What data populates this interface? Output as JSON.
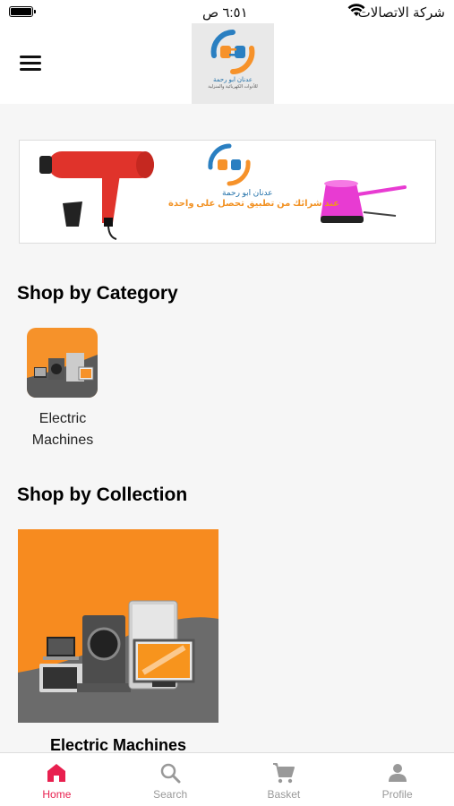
{
  "status_bar": {
    "carrier": "شركة الاتصالات",
    "time": "٦:٥١ ص"
  },
  "header": {
    "logo_name": "عدنان ابو رحمة",
    "logo_subtitle": "للأدوات الكهربائية والمنزلية"
  },
  "banner": {
    "brand_name": "عدنان ابو رحمة",
    "promo_text": "عند شرائك من تطبيق تحصل على واحدة"
  },
  "categories": {
    "title": "Shop by Category",
    "items": [
      {
        "label": "Electric Machines"
      }
    ]
  },
  "collections": {
    "title": "Shop by Collection",
    "items": [
      {
        "label": "Electric Machines"
      }
    ]
  },
  "tabs": [
    {
      "label": "Home",
      "icon": "home-icon",
      "active": true
    },
    {
      "label": "Search",
      "icon": "search-icon",
      "active": false
    },
    {
      "label": "Basket",
      "icon": "cart-icon",
      "active": false
    },
    {
      "label": "Profile",
      "icon": "user-icon",
      "active": false
    }
  ],
  "colors": {
    "accent": "#e8204f",
    "brand_orange": "#f6922a",
    "brand_blue": "#2a7fc1",
    "inactive": "#999999"
  }
}
